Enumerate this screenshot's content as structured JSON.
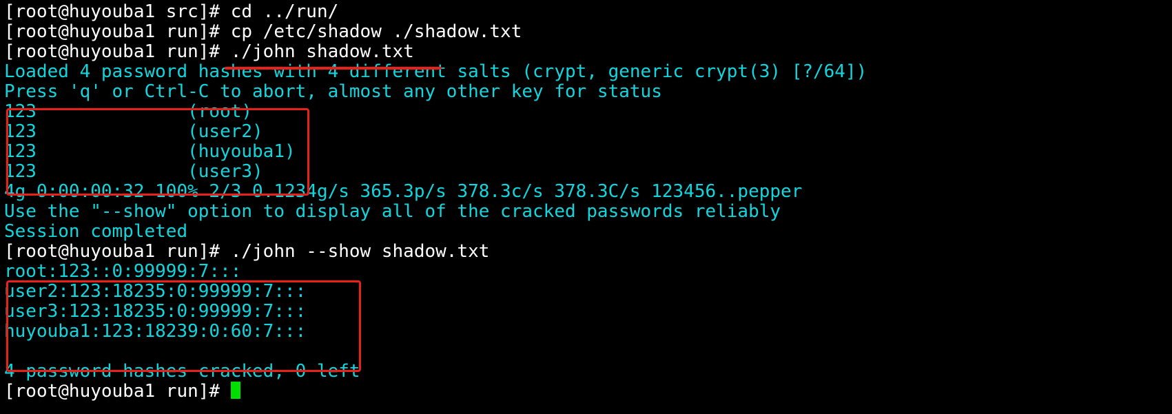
{
  "terminal": {
    "lines": [
      "[root@huyouba1 src]# cd ../run/",
      "[root@huyouba1 run]# cp /etc/shadow ./shadow.txt",
      "[root@huyouba1 run]# ./john shadow.txt",
      "Loaded 4 password hashes with 4 different salts (crypt, generic crypt(3) [?/64])",
      "Press 'q' or Ctrl-C to abort, almost any other key for status",
      "123              (root)",
      "123              (user2)",
      "123              (huyouba1)",
      "123              (user3)",
      "4g 0:00:00:32 100% 2/3 0.1234g/s 365.3p/s 378.3c/s 378.3C/s 123456..pepper",
      "Use the \"--show\" option to display all of the cracked passwords reliably",
      "Session completed",
      "[root@huyouba1 run]# ./john --show shadow.txt",
      "root:123::0:99999:7:::",
      "user2:123:18235:0:99999:7:::",
      "user3:123:18235:0:99999:7:::",
      "huyouba1:123:18239:0:60:7:::",
      "",
      "4 password hashes cracked, 0 left",
      "[root@huyouba1 run]# "
    ]
  },
  "colors": {
    "background": "#000000",
    "prompt_text": "#ffffff",
    "output_text": "#11d6de",
    "cursor": "#00e000",
    "annotation": "#e8211b"
  }
}
